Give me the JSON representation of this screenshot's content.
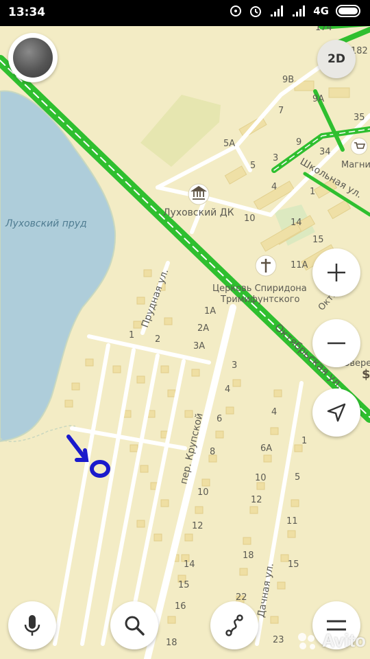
{
  "status_bar": {
    "time": "13:34",
    "network": "4G",
    "icons": [
      "hotspot-icon",
      "alarm-icon",
      "signal-icon",
      "signal-icon",
      "battery-icon"
    ]
  },
  "controls": {
    "view_mode": "2D",
    "zoom_in_icon": "plus-icon",
    "zoom_out_icon": "minus-icon",
    "locate_icon": "navigation-arrow-icon",
    "bottom_icons": [
      "microphone-icon",
      "search-icon",
      "route-icon",
      "menu-icon"
    ]
  },
  "map": {
    "water": "Луховский пруд",
    "poi_culture": "Луховский ДК",
    "church_line1": "Церковь Спиридона",
    "church_line2": "Тримифунтского",
    "shop_partial": "Магни",
    "shop_partial2": "Зверев",
    "streets": {
      "oktyabrskaya": "Октябрьская ул.",
      "oktyabrskaya_short": "Октябрьск",
      "shkolnaya": "Школьная ул.",
      "prudnaya": "Прудная ул.",
      "krupskoy": "пер. Крупской",
      "dachnaya": "Дачная ул."
    },
    "house_numbers": {
      "n174": "174",
      "n182": "182",
      "n9v": "9В",
      "n9a": "9А",
      "n35": "35",
      "n7": "7",
      "n9": "9",
      "n34": "34",
      "n5a": "5А",
      "n3": "3",
      "n5": "5",
      "n4": "4",
      "n1": "1",
      "n10": "10",
      "n14": "14",
      "n15": "15",
      "n11a": "11А",
      "k1a": "1А",
      "k2a": "2А",
      "k3a": "3А",
      "k1": "1",
      "k2": "2",
      "c3": "3",
      "c4": "4",
      "c6": "6",
      "c8": "8",
      "c10": "10",
      "c12": "12",
      "c14": "14",
      "c15": "15",
      "c16": "16",
      "c18": "18",
      "d4": "4",
      "d6a": "6А",
      "d10": "10",
      "d12": "12",
      "d18": "18",
      "d22": "22",
      "d23": "23",
      "e1": "1",
      "e5": "5",
      "e11": "11",
      "e15": "15"
    },
    "dollar": "$"
  },
  "colors": {
    "land": "#f3ecc5",
    "water": "#aecdda",
    "road_green": "#3cc93a",
    "annotation": "#1a1acc"
  },
  "watermark": "Avito"
}
